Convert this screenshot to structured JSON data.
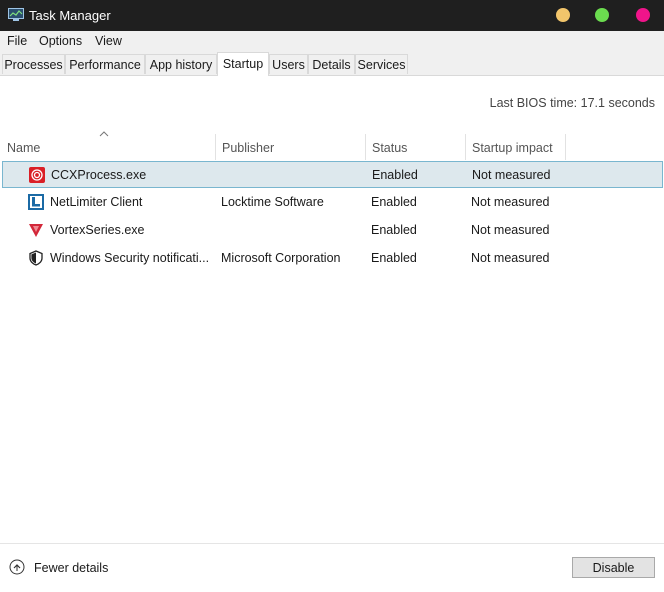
{
  "window": {
    "title": "Task Manager"
  },
  "menu": [
    "File",
    "Options",
    "View"
  ],
  "tabs": [
    {
      "label": "Processes"
    },
    {
      "label": "Performance"
    },
    {
      "label": "App history"
    },
    {
      "label": "Startup",
      "active": true
    },
    {
      "label": "Users"
    },
    {
      "label": "Details"
    },
    {
      "label": "Services"
    }
  ],
  "bios": {
    "label": "Last BIOS time:",
    "value": "17.1 seconds"
  },
  "columns": {
    "name": "Name",
    "publisher": "Publisher",
    "status": "Status",
    "impact": "Startup impact"
  },
  "rows": [
    {
      "name": "CCXProcess.exe",
      "publisher": "",
      "status": "Enabled",
      "impact": "Not measured",
      "icon": "ccx-icon",
      "selected": true
    },
    {
      "name": "NetLimiter Client",
      "publisher": "Locktime Software",
      "status": "Enabled",
      "impact": "Not measured",
      "icon": "netlimiter-icon"
    },
    {
      "name": "VortexSeries.exe",
      "publisher": "",
      "status": "Enabled",
      "impact": "Not measured",
      "icon": "vortex-icon"
    },
    {
      "name": "Windows Security notificati...",
      "publisher": "Microsoft Corporation",
      "status": "Enabled",
      "impact": "Not measured",
      "icon": "shield-icon"
    }
  ],
  "footer": {
    "fewer_details": "Fewer details",
    "disable": "Disable"
  },
  "colors": {
    "titlebar": "#1f1f1f",
    "selection": "#dde8ed",
    "selection_border": "#79b6cf",
    "min": "#f2c56b",
    "max": "#6bdc4f",
    "close": "#f0148a"
  }
}
